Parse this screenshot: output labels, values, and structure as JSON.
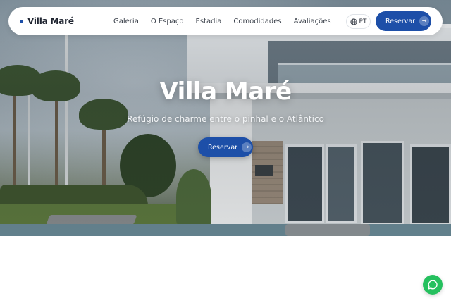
{
  "brand": {
    "name": "Villa Maré",
    "accent_color": "#1d4fa8"
  },
  "nav": {
    "links": [
      "Galeria",
      "O Espaço",
      "Estadia",
      "Comodidades",
      "Avaliações"
    ],
    "language": {
      "icon": "globe-icon",
      "code": "PT"
    },
    "reserve_button": {
      "label": "Reservar",
      "icon": "arrow-right-icon"
    }
  },
  "hero": {
    "title": "Villa Maré",
    "subtitle": "Refúgio de charme entre o pinhal e o Atlântico",
    "reserve_button": {
      "label": "Reservar",
      "icon": "arrow-right-icon"
    }
  },
  "chat_button": {
    "icon": "chat-bubble-icon",
    "color": "#25c05e"
  }
}
